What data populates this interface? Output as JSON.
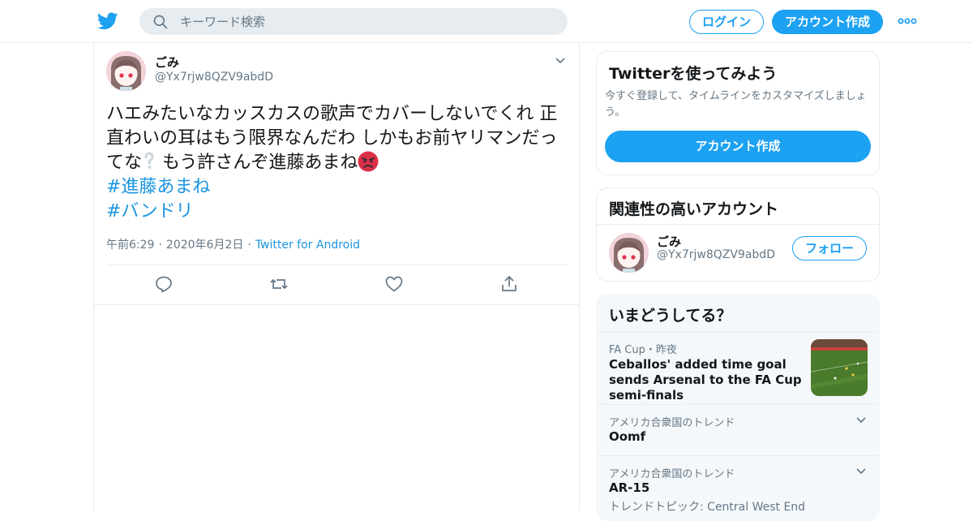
{
  "header": {
    "logo_icon": "twitter-bird-icon",
    "search_placeholder": "キーワード検索",
    "login_label": "ログイン",
    "signup_label": "アカウント作成",
    "more_icon": "more-dots-icon",
    "accent_color": "#1da1f2"
  },
  "tweet": {
    "name": "ごみ",
    "handle": "@Yx7rjw8QZV9abdD",
    "text_part1": "ハエみたいなカッスカスの歌声でカバーしないでくれ 正直わいの耳はもう限界なんだわ しかもお前ヤリマンだってな",
    "text_part2": " もう許さんぞ進藤あまね",
    "hashtags": [
      "#進藤あまね",
      "#バンドリ"
    ],
    "time": "午前6:29",
    "date": "2020年6月2日",
    "source": "Twitter for Android",
    "actions": [
      "reply-icon",
      "retweet-icon",
      "like-icon",
      "share-icon"
    ]
  },
  "sidebar": {
    "signup_card": {
      "title": "Twitterを使ってみよう",
      "description": "今すぐ登録して、タイムラインをカスタマイズしましょう。",
      "button_label": "アカウント作成"
    },
    "related_card": {
      "title": "関連性の高いアカウント",
      "name": "ごみ",
      "handle": "@Yx7rjw8QZV9abdD",
      "follow_label": "フォロー"
    },
    "trends_card": {
      "title": "いまどうしてる？",
      "items": [
        {
          "meta": "FA Cup・昨夜",
          "headline": "Ceballos' added time goal sends Arsenal to the FA Cup semi-finals"
        },
        {
          "meta": "アメリカ合衆国のトレンド",
          "name": "Oomf"
        },
        {
          "meta": "アメリカ合衆国のトレンド",
          "name": "AR-15",
          "topic": "トレンドトピック: Central West End"
        }
      ]
    }
  }
}
